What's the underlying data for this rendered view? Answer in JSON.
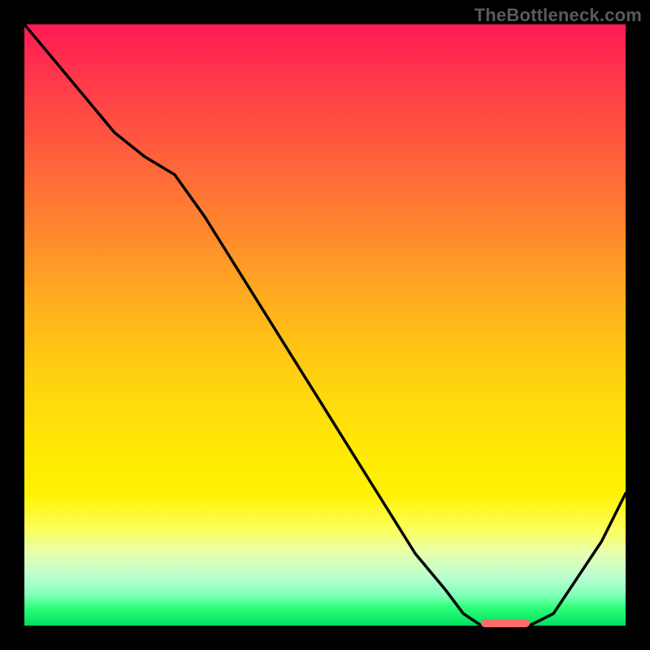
{
  "watermark": "TheBottleneck.com",
  "colors": {
    "background": "#000000",
    "curve": "#000000",
    "marker": "#ff6b6b",
    "gradient_top": "#ff1a55",
    "gradient_bottom": "#00e060"
  },
  "chart_data": {
    "type": "line",
    "title": "",
    "xlabel": "",
    "ylabel": "",
    "xlim": [
      0,
      100
    ],
    "ylim": [
      0,
      100
    ],
    "grid": false,
    "series": [
      {
        "name": "bottleneck-curve",
        "x": [
          0,
          5,
          10,
          15,
          20,
          25,
          30,
          35,
          40,
          45,
          50,
          55,
          60,
          65,
          70,
          73,
          76,
          80,
          84,
          88,
          92,
          96,
          100
        ],
        "y": [
          100,
          94,
          88,
          82,
          78,
          75,
          68,
          60,
          52,
          44,
          36,
          28,
          20,
          12,
          6,
          2,
          0,
          0,
          0,
          2,
          8,
          14,
          22
        ]
      }
    ],
    "marker": {
      "x_start": 76,
      "x_end": 84,
      "y": 0,
      "label": "optimal-range"
    },
    "annotations": []
  }
}
